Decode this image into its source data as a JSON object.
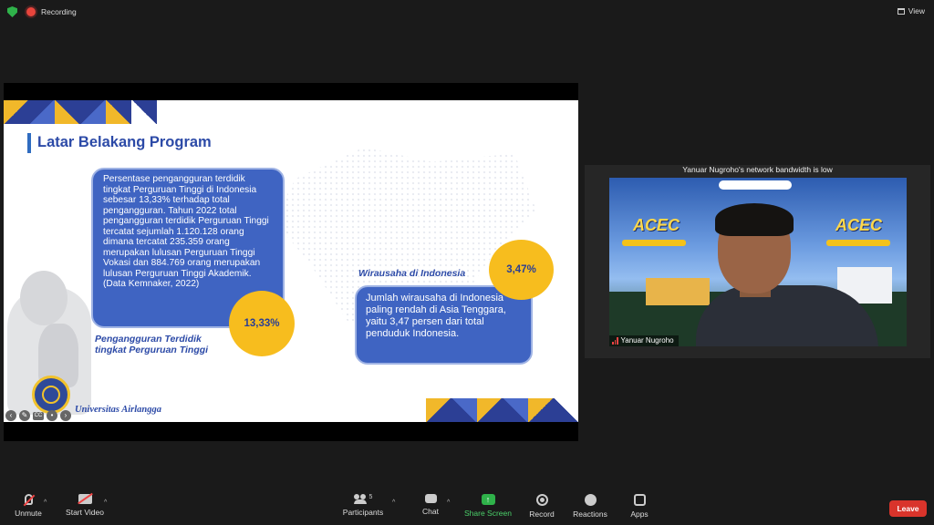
{
  "top_bar": {
    "recording_label": "Recording",
    "view_label": "View"
  },
  "shared_slide": {
    "title": "Latar Belakang Program",
    "left_box_text": "Persentase pengangguran terdidik tingkat Perguruan Tinggi di Indonesia sebesar 13,33% terhadap total pengangguran. Tahun 2022 total pengangguran terdidik Perguruan Tinggi tercatat sejumlah 1.120.128 orang dimana tercatat 235.359 orang merupakan lulusan Perguruan Tinggi Vokasi dan 884.769 orang merupakan lulusan Perguruan Tinggi Akademik. (Data Kemnaker, 2022)",
    "left_badge": "13,33%",
    "left_caption": "Pengangguran Terdidik tingkat Perguruan Tinggi",
    "right_caption": "Wirausaha di Indonesia",
    "right_badge": "3,47%",
    "right_box_text": "Jumlah wirausaha di Indonesia paling rendah di Asia Tenggara, yaitu 3,47 persen dari total penduduk Indonesia.",
    "university_logo_text": "Universitas Airlangga",
    "cc_label": "CC",
    "accent_colors": {
      "navy": "#2c4aa7",
      "blue": "#3f64c2",
      "yellow": "#f7bd1e"
    }
  },
  "video_tile": {
    "bandwidth_notice": "Yanuar Nugroho's network bandwidth is low",
    "participant_name": "Yanuar Nugroho",
    "background_brand_left": "ACEC",
    "background_brand_right": "ACEC"
  },
  "toolbar": {
    "unmute_label": "Unmute",
    "start_video_label": "Start Video",
    "participants_label": "Participants",
    "participants_count": "5",
    "chat_label": "Chat",
    "share_screen_label": "Share Screen",
    "record_label": "Record",
    "reactions_label": "Reactions",
    "apps_label": "Apps",
    "leave_label": "Leave"
  }
}
